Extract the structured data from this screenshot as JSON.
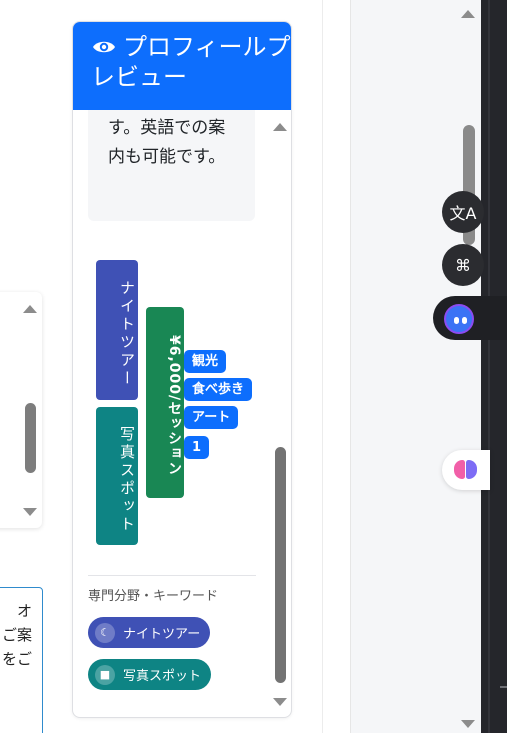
{
  "panel": {
    "title": "プロフィールプレビュー",
    "description": "す。英語での案内も可能です。",
    "tags": {
      "night_tour": "ナイトツアー",
      "photo_spot": "写真スポット",
      "price": "¥6,000/セッション"
    },
    "keywords": [
      "観光",
      "食べ歩き",
      "アート",
      "1"
    ],
    "expertise_label": "専門分野・キーワード",
    "pills": [
      {
        "label": "ナイトツアー",
        "icon": "moon-icon"
      },
      {
        "label": "写真スポット",
        "icon": "camera-icon"
      }
    ]
  },
  "left_textbox": {
    "lines": [
      "オ",
      "ご案",
      "をご"
    ]
  },
  "fabs": {
    "translate_icon": "translate-icon",
    "command_icon": "command-icon",
    "assistant_icon": "ai-assistant-icon",
    "brain_icon": "brain-icon"
  },
  "colors": {
    "header_blue": "#0d6efd",
    "night_indigo": "#3f51b5",
    "photo_teal": "#0e8484",
    "price_green": "#198754"
  }
}
